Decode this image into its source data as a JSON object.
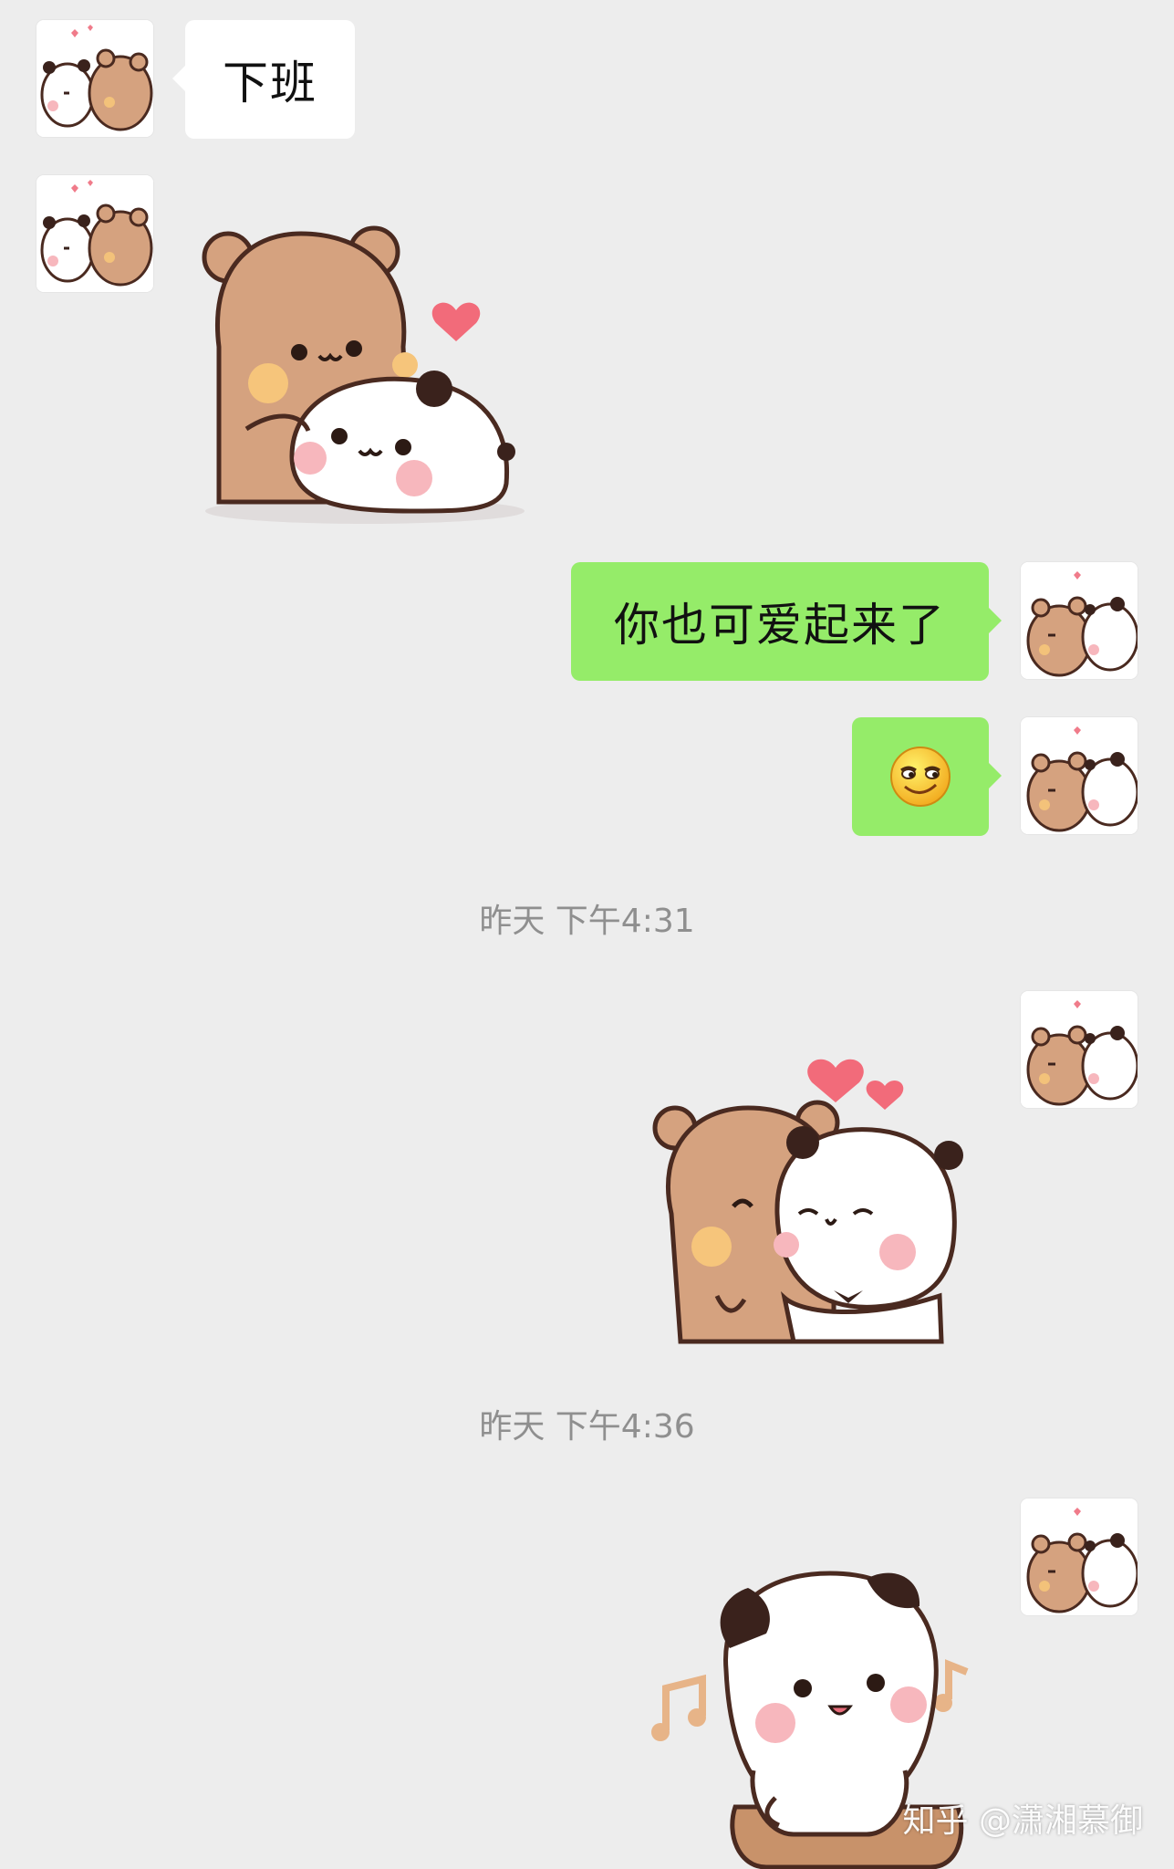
{
  "messages": [
    {
      "sender": "other",
      "type": "text",
      "text": "下班"
    },
    {
      "sender": "other",
      "type": "sticker",
      "sticker": "bear-hugging-panda-sticker"
    },
    {
      "sender": "me",
      "type": "text",
      "text": "你也可爱起来了"
    },
    {
      "sender": "me",
      "type": "emoji",
      "emoji": "😏"
    },
    {
      "type": "timestamp",
      "text": "昨天 下午4:31"
    },
    {
      "sender": "me",
      "type": "sticker",
      "sticker": "bear-and-panda-hearts-sticker"
    },
    {
      "type": "timestamp",
      "text": "昨天 下午4:36"
    },
    {
      "sender": "me",
      "type": "sticker",
      "sticker": "panda-music-notes-sticker"
    }
  ],
  "watermark": "知乎 @潇湘慕御",
  "colors": {
    "background": "#ededed",
    "incoming_bubble": "#ffffff",
    "outgoing_bubble": "#95ec69",
    "timestamp_text": "#8f8f8f"
  }
}
